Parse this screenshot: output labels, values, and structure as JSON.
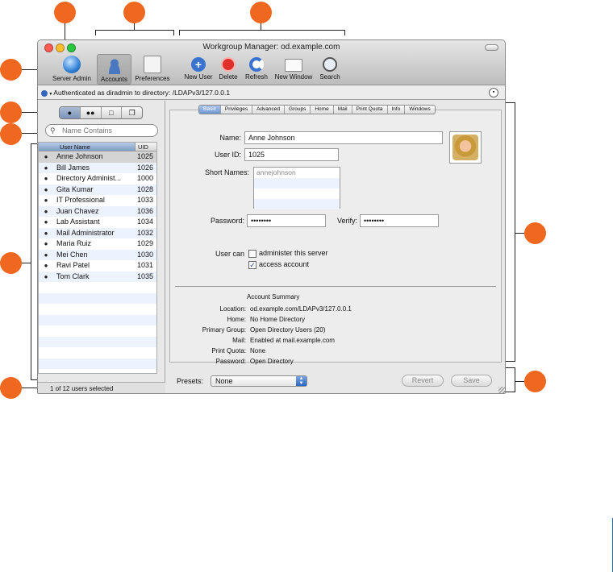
{
  "window": {
    "title": "Workgroup Manager: od.example.com"
  },
  "toolbar": {
    "server_admin": "Server Admin",
    "accounts": "Accounts",
    "preferences": "Preferences",
    "new_user": "New User",
    "delete": "Delete",
    "refresh": "Refresh",
    "new_window": "New Window",
    "search": "Search"
  },
  "auth_text": "Authenticated as diradmin to directory: /LDAPv3/127.0.0.1",
  "search": {
    "placeholder": "Name Contains"
  },
  "list": {
    "headers": {
      "name": "User Name",
      "uid": "UID"
    },
    "rows": [
      {
        "name": "Anne Johnson",
        "uid": "1025"
      },
      {
        "name": "Bill James",
        "uid": "1026"
      },
      {
        "name": "Directory Administ...",
        "uid": "1000"
      },
      {
        "name": "Gita Kumar",
        "uid": "1028"
      },
      {
        "name": "IT Professional",
        "uid": "1033"
      },
      {
        "name": "Juan Chavez",
        "uid": "1036"
      },
      {
        "name": "Lab Assistant",
        "uid": "1034"
      },
      {
        "name": "Mail Administrator",
        "uid": "1032"
      },
      {
        "name": "Maria Ruiz",
        "uid": "1029"
      },
      {
        "name": "Mei Chen",
        "uid": "1030"
      },
      {
        "name": "Ravi Patel",
        "uid": "1031"
      },
      {
        "name": "Tom Clark",
        "uid": "1035"
      }
    ]
  },
  "status": "1 of 12 users selected",
  "tabs": [
    "Basic",
    "Privileges",
    "Advanced",
    "Groups",
    "Home",
    "Mail",
    "Print Quota",
    "Info",
    "Windows"
  ],
  "form": {
    "name_label": "Name:",
    "name_value": "Anne Johnson",
    "userid_label": "User ID:",
    "userid_value": "1025",
    "short_label": "Short Names:",
    "short_value": "annejohnson",
    "password_label": "Password:",
    "password_value": "••••••••",
    "verify_label": "Verify:",
    "verify_value": "••••••••",
    "usercan_label": "User can",
    "administer_label": "administer this server",
    "access_label": "access account",
    "access_check": "✓"
  },
  "summary": {
    "title": "Account Summary",
    "items": [
      {
        "label": "Location:",
        "value": "od.example.com/LDAPv3/127.0.0.1"
      },
      {
        "label": "Home:",
        "value": "No Home Directory"
      },
      {
        "label": "Primary Group:",
        "value": "Open Directory Users (20)"
      },
      {
        "label": "Mail:",
        "value": "Enabled at mail.example.com"
      },
      {
        "label": "Print Quota:",
        "value": "None"
      },
      {
        "label": "Password:",
        "value": "Open Directory"
      }
    ]
  },
  "bottom": {
    "presets_label": "Presets:",
    "presets_value": "None",
    "revert": "Revert",
    "save": "Save"
  },
  "colors": {
    "callout": "#f06820",
    "selection_blue": "#7e9dc8"
  }
}
